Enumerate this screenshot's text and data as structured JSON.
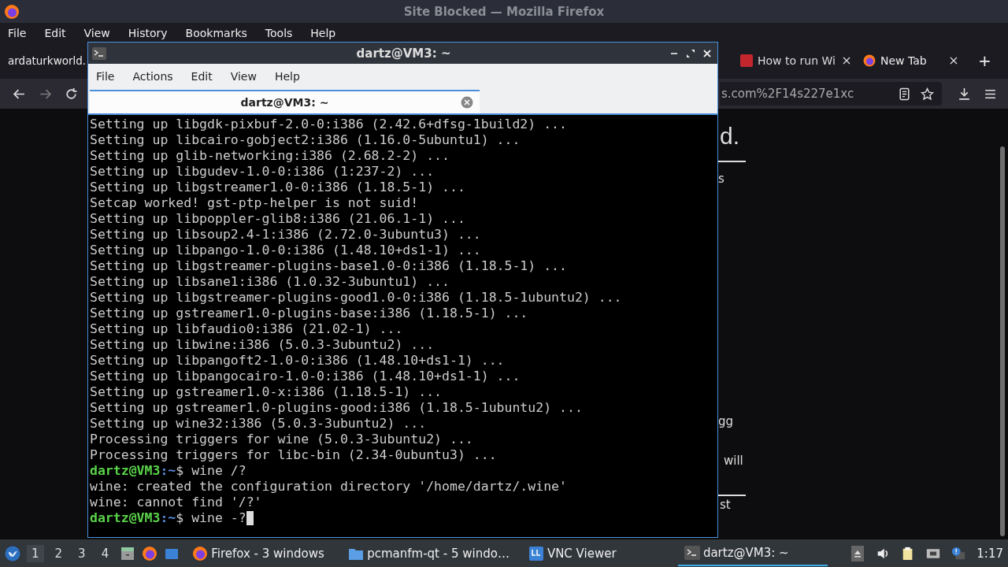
{
  "browser": {
    "title": "Site Blocked — Mozilla Firefox",
    "menu": [
      "File",
      "Edit",
      "View",
      "History",
      "Bookmarks",
      "Tools",
      "Help"
    ],
    "tabs": [
      {
        "label": "ardaturkworld.",
        "selected": false,
        "kind": "text"
      },
      {
        "label": "How to run Wi",
        "selected": false,
        "kind": "pcw"
      },
      {
        "label": "New Tab",
        "selected": false,
        "kind": "firefox"
      }
    ],
    "new_tab": "+",
    "url": "s.com%2F14s227e1xc",
    "content": [
      {
        "kind": "heading",
        "text": "d."
      },
      {
        "kind": "rule"
      },
      {
        "kind": "text",
        "text": "s"
      },
      {
        "kind": "text",
        "text": "gg"
      },
      {
        "kind": "text",
        "text": "will"
      },
      {
        "kind": "rule"
      },
      {
        "kind": "text",
        "text": "st"
      }
    ]
  },
  "terminal": {
    "title": "dartz@VM3: ~",
    "menu": [
      "File",
      "Actions",
      "Edit",
      "View",
      "Help"
    ],
    "tab": {
      "label": "dartz@VM3: ~",
      "selected": true
    },
    "lines": [
      {
        "kind": "output",
        "text": "Setting up libgdk-pixbuf-2.0-0:i386 (2.42.6+dfsg-1build2) ..."
      },
      {
        "kind": "output",
        "text": "Setting up libcairo-gobject2:i386 (1.16.0-5ubuntu1) ..."
      },
      {
        "kind": "output",
        "text": "Setting up glib-networking:i386 (2.68.2-2) ..."
      },
      {
        "kind": "output",
        "text": "Setting up libgudev-1.0-0:i386 (1:237-2) ..."
      },
      {
        "kind": "output",
        "text": "Setting up libgstreamer1.0-0:i386 (1.18.5-1) ..."
      },
      {
        "kind": "output",
        "text": "Setcap worked! gst-ptp-helper is not suid!"
      },
      {
        "kind": "output",
        "text": "Setting up libpoppler-glib8:i386 (21.06.1-1) ..."
      },
      {
        "kind": "output",
        "text": "Setting up libsoup2.4-1:i386 (2.72.0-3ubuntu3) ..."
      },
      {
        "kind": "output",
        "text": "Setting up libpango-1.0-0:i386 (1.48.10+ds1-1) ..."
      },
      {
        "kind": "output",
        "text": "Setting up libgstreamer-plugins-base1.0-0:i386 (1.18.5-1) ..."
      },
      {
        "kind": "output",
        "text": "Setting up libsane1:i386 (1.0.32-3ubuntu1) ..."
      },
      {
        "kind": "output",
        "text": "Setting up libgstreamer-plugins-good1.0-0:i386 (1.18.5-1ubuntu2) ..."
      },
      {
        "kind": "output",
        "text": "Setting up gstreamer1.0-plugins-base:i386 (1.18.5-1) ..."
      },
      {
        "kind": "output",
        "text": "Setting up libfaudio0:i386 (21.02-1) ..."
      },
      {
        "kind": "output",
        "text": "Setting up libwine:i386 (5.0.3-3ubuntu2) ..."
      },
      {
        "kind": "output",
        "text": "Setting up libpangoft2-1.0-0:i386 (1.48.10+ds1-1) ..."
      },
      {
        "kind": "output",
        "text": "Setting up libpangocairo-1.0-0:i386 (1.48.10+ds1-1) ..."
      },
      {
        "kind": "output",
        "text": "Setting up gstreamer1.0-x:i386 (1.18.5-1) ..."
      },
      {
        "kind": "output",
        "text": "Setting up gstreamer1.0-plugins-good:i386 (1.18.5-1ubuntu2) ..."
      },
      {
        "kind": "output",
        "text": "Setting up wine32:i386 (5.0.3-3ubuntu2) ..."
      },
      {
        "kind": "output",
        "text": "Processing triggers for wine (5.0.3-3ubuntu2) ..."
      },
      {
        "kind": "output",
        "text": "Processing triggers for libc-bin (2.34-0ubuntu3) ..."
      },
      {
        "kind": "prompt",
        "user": "dartz@VM3",
        "path": ":~",
        "command": "$ wine /?",
        "cursor": false
      },
      {
        "kind": "output",
        "text": "wine: created the configuration directory '/home/dartz/.wine'"
      },
      {
        "kind": "output",
        "text": "wine: cannot find '/?'"
      },
      {
        "kind": "prompt",
        "user": "dartz@VM3",
        "path": ":~",
        "command": "$ wine -?",
        "cursor": true
      }
    ]
  },
  "taskbar": {
    "workspaces": [
      {
        "label": "1",
        "selected": true
      },
      {
        "label": "2",
        "selected": false
      },
      {
        "label": "3",
        "selected": false
      },
      {
        "label": "4",
        "selected": false
      }
    ],
    "tasks": [
      {
        "kind": "firefox",
        "label": "Firefox - 3 windows",
        "selected": false
      },
      {
        "kind": "folder",
        "label": "pcmanfm-qt - 5 windo…",
        "selected": false
      },
      {
        "kind": "vnc",
        "label": "VNC Viewer",
        "selected": false
      },
      {
        "kind": "terminal",
        "label": "dartz@VM3: ~",
        "selected": true
      }
    ],
    "clock": "1:17"
  }
}
